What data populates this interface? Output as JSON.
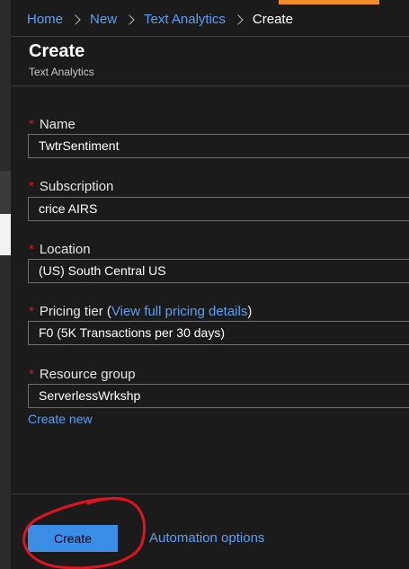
{
  "breadcrumb": {
    "items": [
      "Home",
      "New",
      "Text Analytics"
    ],
    "current": "Create"
  },
  "blade": {
    "title": "Create",
    "subtitle": "Text Analytics"
  },
  "form": {
    "required_marker": "*",
    "name": {
      "label": "Name",
      "value": "TwtrSentiment"
    },
    "subscription": {
      "label": "Subscription",
      "value": "crice AIRS"
    },
    "location": {
      "label": "Location",
      "value": "(US) South Central US"
    },
    "pricing_tier": {
      "label": "Pricing tier (",
      "link": "View full pricing details",
      "label_end": ")",
      "value": "F0 (5K Transactions per 30 days)"
    },
    "resource_group": {
      "label": "Resource group",
      "value": "ServerlessWrkshp",
      "create_new": "Create new"
    }
  },
  "footer": {
    "create_label": "Create",
    "automation_label": "Automation options"
  },
  "colors": {
    "accent_link": "#5aa0f2",
    "primary_button": "#3a8ee6",
    "required": "#e81123",
    "focus_border": "#9b4dca",
    "annotation": "#e0141e"
  }
}
